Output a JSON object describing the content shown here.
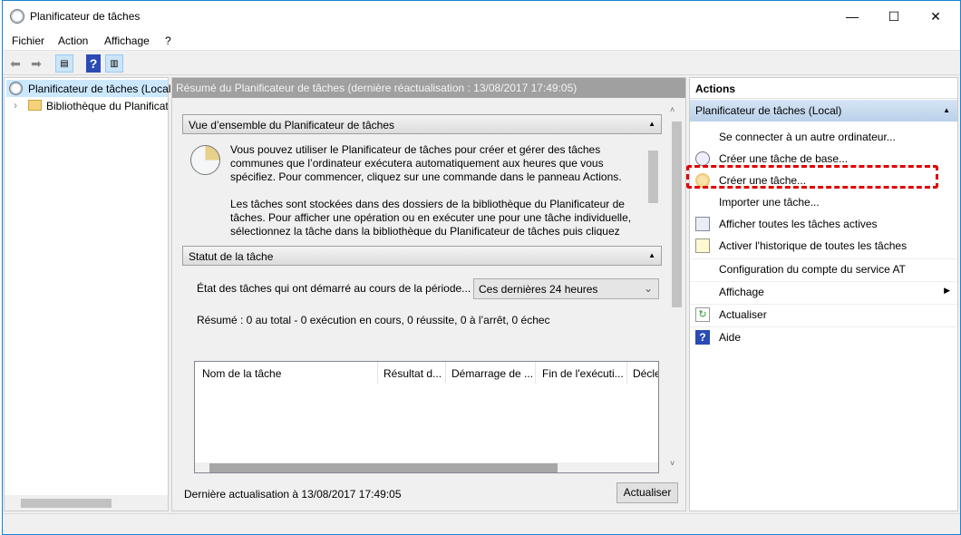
{
  "window": {
    "title": "Planificateur de tâches",
    "minimize": "—",
    "maximize": "☐",
    "close": "✕"
  },
  "menu": [
    "Fichier",
    "Action",
    "Affichage",
    "?"
  ],
  "toolbar": {
    "back": "back-arrow-icon",
    "forward": "forward-arrow-icon",
    "show_tree": "console-tree-icon",
    "help": "help-icon",
    "show_actions": "action-pane-icon"
  },
  "tree": {
    "root": "Planificateur de tâches (Local",
    "library": "Bibliothèque du Planificat"
  },
  "center": {
    "header": "Résumé du Planificateur de tâches (dernière réactualisation : 13/08/2017 17:49:05)",
    "overview": {
      "title": "Vue d’ensemble du Planificateur de tâches",
      "p1": "Vous pouvez utiliser le Planificateur de tâches pour créer et gérer des tâches communes que l’ordinateur exécutera automatiquement aux heures que vous spécifiez. Pour commencer, cliquez sur une commande dans le panneau Actions.",
      "p2": "Les tâches sont stockées dans des dossiers de la bibliothèque du Planificateur de tâches. Pour afficher une opération ou en exécuter une pour une tâche individuelle, sélectionnez la tâche dans la bibliothèque du Planificateur de tâches puis cliquez"
    },
    "status": {
      "title": "Statut de la tâche",
      "period_label": "État des tâches qui ont démarré au cours de la période...",
      "period_value": "Ces dernières 24 heures",
      "summary": "Résumé : 0 au total - 0 exécution en cours, 0 réussite, 0 à l’arrêt, 0 échec",
      "columns": [
        "Nom de la tâche",
        "Résultat d...",
        "Démarrage de ...",
        "Fin de l'exécuti...",
        "Décle"
      ]
    },
    "last_refresh": "Dernière actualisation à 13/08/2017 17:49:05",
    "refresh_button": "Actualiser"
  },
  "actions": {
    "title": "Actions",
    "section": "Planificateur de tâches (Local)",
    "items": [
      {
        "label": "Se connecter à un autre ordinateur...",
        "icon": ""
      },
      {
        "label": "Créer une tâche de base...",
        "icon": "create-basic-task-icon"
      },
      {
        "label": "Créer une tâche...",
        "icon": "create-task-icon",
        "highlighted": true
      },
      {
        "label": "Importer une tâche...",
        "icon": ""
      },
      {
        "label": "Afficher toutes les tâches actives",
        "icon": "running-tasks-icon"
      },
      {
        "label": "Activer l'historique de toutes les tâches",
        "icon": "history-icon"
      },
      {
        "label": "Configuration du compte du service AT",
        "icon": ""
      },
      {
        "label": "Affichage",
        "icon": "",
        "submenu": true
      },
      {
        "label": "Actualiser",
        "icon": "refresh-icon"
      },
      {
        "label": "Aide",
        "icon": "help-icon"
      }
    ]
  },
  "colors": {
    "highlight": "#e00000",
    "section_blue": "#c5d9ee",
    "header_gray": "#a0a0a0"
  }
}
